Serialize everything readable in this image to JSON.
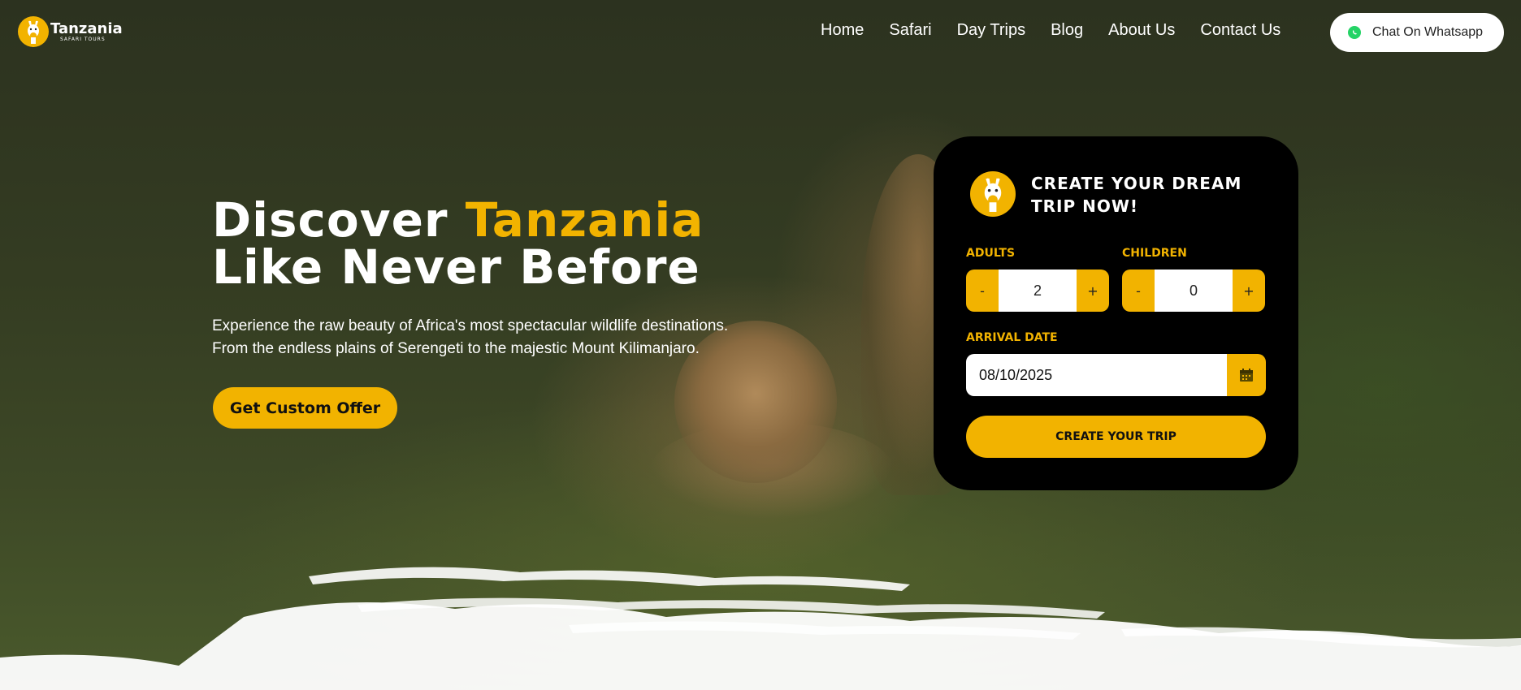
{
  "brand": {
    "name": "Tanzania",
    "tagline": "SAFARI TOURS",
    "logo_icon": "giraffe-icon",
    "accent_color": "#f2b300"
  },
  "nav": {
    "links": [
      "Home",
      "Safari",
      "Day Trips",
      "Blog",
      "About Us",
      "Contact Us"
    ],
    "whatsapp_label": "Chat On Whatsapp",
    "whatsapp_icon": "whatsapp-icon"
  },
  "hero": {
    "headline_part1": "Discover ",
    "headline_accent": "Tanzania",
    "headline_line2": "Like Never Before",
    "subtext_line1": "Experience the raw beauty of Africa's most spectacular wildlife destinations.",
    "subtext_line2": "From the endless plains of Serengeti to the majestic Mount Kilimanjaro.",
    "cta_label": "Get Custom Offer"
  },
  "trip_form": {
    "title": "CREATE YOUR DREAM TRIP NOW!",
    "adults_label": "ADULTS",
    "adults_value": "2",
    "children_label": "CHILDREN",
    "children_value": "0",
    "minus_label": "-",
    "plus_label": "+",
    "arrival_label": "ARRIVAL DATE",
    "arrival_value": "08/10/2025",
    "calendar_icon": "calendar-icon",
    "submit_label": "CREATE YOUR TRIP"
  }
}
